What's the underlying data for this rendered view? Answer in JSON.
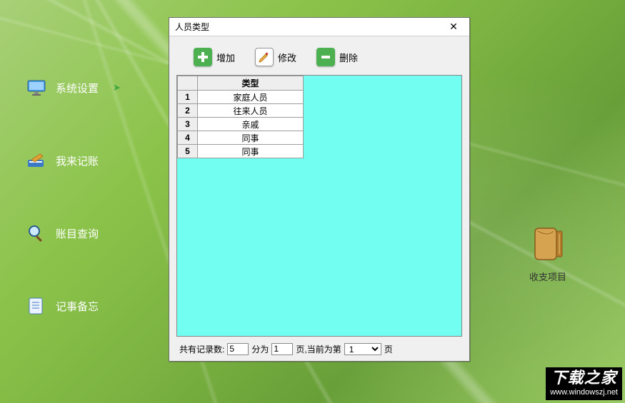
{
  "sidebar": {
    "items": [
      {
        "label": "系统设置",
        "icon": "monitor-icon",
        "active": true
      },
      {
        "label": "我来记账",
        "icon": "ledger-icon",
        "active": false
      },
      {
        "label": "账目查询",
        "icon": "search-icon",
        "active": false
      },
      {
        "label": "记事备忘",
        "icon": "notes-icon",
        "active": false
      }
    ]
  },
  "desktop": {
    "folder_label": "收支项目"
  },
  "dialog": {
    "title": "人员类型",
    "toolbar": {
      "add_label": "增加",
      "edit_label": "修改",
      "delete_label": "删除"
    },
    "table": {
      "header": "类型",
      "rows": [
        "家庭人员",
        "往来人员",
        "亲戚",
        "同事",
        "同事"
      ]
    },
    "status": {
      "label_records": "共有记录数:",
      "record_count": "5",
      "label_split": "分为",
      "page_count": "1",
      "label_pages_current": "页,当前为第",
      "current_page": "1",
      "label_page_suffix": "页"
    }
  },
  "watermark": {
    "title": "下载之家",
    "url": "www.windowszj.net"
  }
}
